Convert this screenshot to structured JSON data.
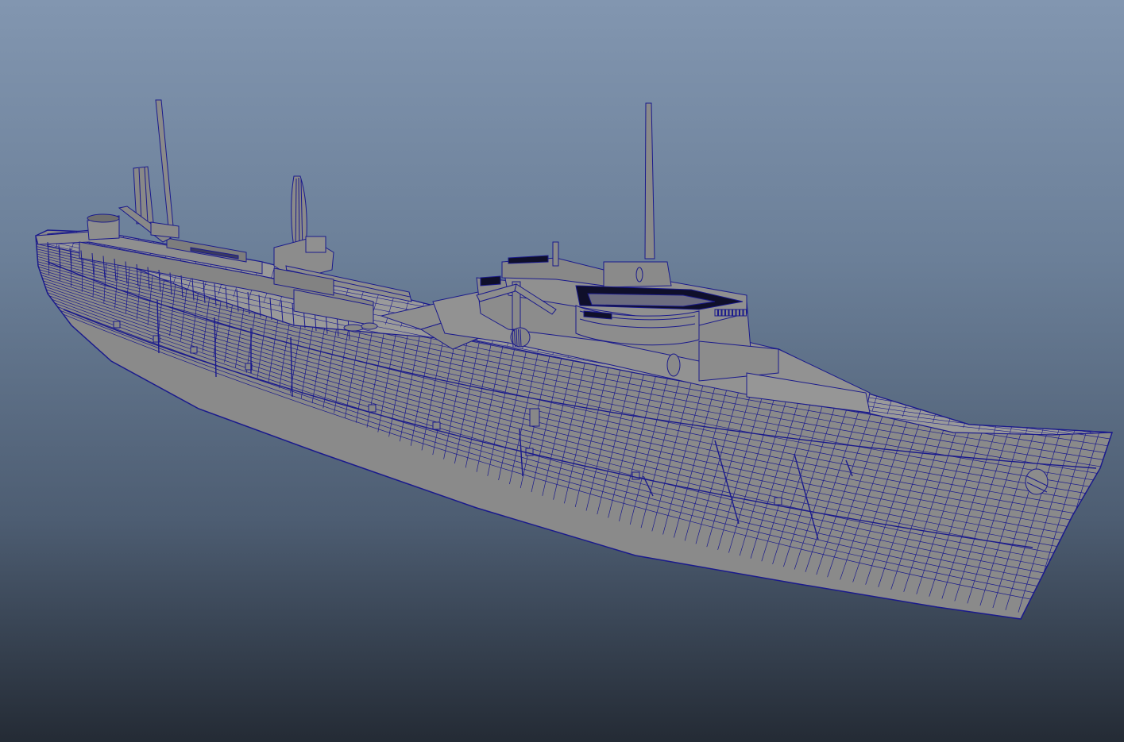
{
  "viewport": {
    "background_top": "#8296b0",
    "background_bottom": "#242b35",
    "model_fill": "#8a8a8a",
    "model_fill_light": "#9a9a9a",
    "model_fill_dark": "#6e6e6e",
    "wireframe_color": "#1a1a8c",
    "interior_dark": "#0f0f2a"
  },
  "model": {
    "object": "ship-hull",
    "display_mode": "wireframe-on-shaded"
  }
}
